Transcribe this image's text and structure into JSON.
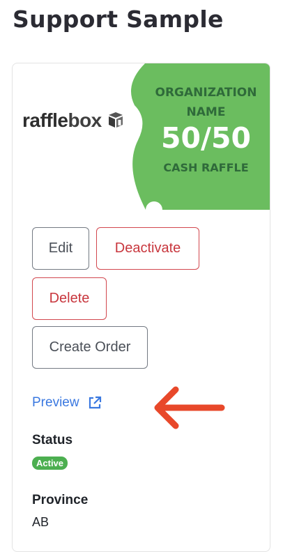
{
  "page": {
    "title": "Support Sample"
  },
  "banner": {
    "logo_prefix": "raffle",
    "logo_suffix": "box",
    "org_line1": "ORGANIZATION",
    "org_line2": "NAME",
    "big_text": "50/50",
    "cash_text": "CASH RAFFLE",
    "ticket_color": "#6bbd5f"
  },
  "actions": {
    "edit_label": "Edit",
    "deactivate_label": "Deactivate",
    "delete_label": "Delete",
    "create_order_label": "Create Order"
  },
  "preview": {
    "label": "Preview",
    "icon": "external-link-icon"
  },
  "details": {
    "status_label": "Status",
    "status_value": "Active",
    "province_label": "Province",
    "province_value": "AB"
  },
  "colors": {
    "danger": "#c8363d",
    "link": "#3a78e0",
    "success": "#4caf50",
    "annotation_arrow": "#e8482a"
  }
}
